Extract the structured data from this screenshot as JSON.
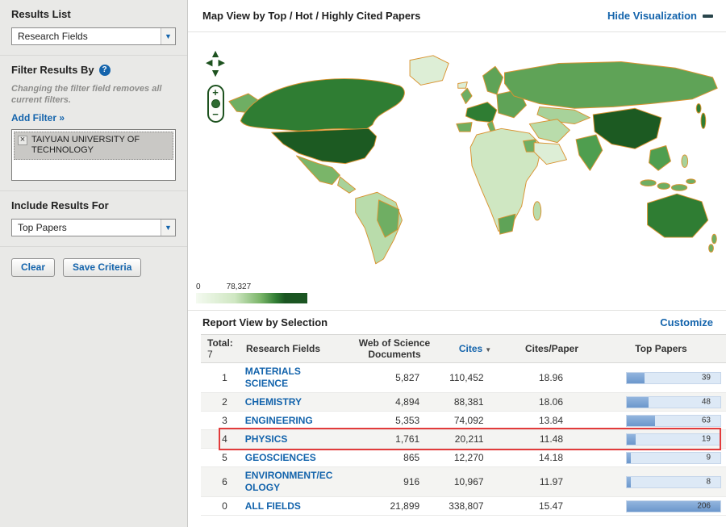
{
  "sidebar": {
    "results_list": {
      "label": "Results List",
      "value": "Research Fields"
    },
    "filter": {
      "title": "Filter Results By",
      "help": "?",
      "note": "Changing the filter field removes all current filters.",
      "add_filter": "Add Filter »",
      "tag": {
        "close": "×",
        "text": "TAIYUAN UNIVERSITY OF TECHNOLOGY"
      }
    },
    "include": {
      "label": "Include Results For",
      "value": "Top Papers"
    },
    "buttons": {
      "clear": "Clear",
      "save": "Save Criteria"
    }
  },
  "map": {
    "title": "Map View by Top / Hot / Highly Cited Papers",
    "hide_link": "Hide Visualization",
    "legend": {
      "min": "0",
      "max": "78,327"
    },
    "controls": {
      "pan_up": "▲",
      "pan_down": "▼",
      "pan_left": "◀",
      "pan_right": "▶",
      "zoom_in": "+",
      "zoom_out": "−"
    }
  },
  "report": {
    "title": "Report View by Selection",
    "customize": "Customize",
    "header": {
      "total_label": "Total:",
      "total_value": "7",
      "research_fields": "Research Fields",
      "docs": "Web of Science Documents",
      "cites": "Cites",
      "sort_icon": "▼",
      "cites_per_paper": "Cites/Paper",
      "top_papers": "Top Papers"
    },
    "rows": [
      {
        "rank": "1",
        "field": "MATERIALS SCIENCE",
        "web_of_science_documents": "5,827",
        "cites": "110,452",
        "cites_per_paper": "18.96",
        "top_papers": "39",
        "highlight": false
      },
      {
        "rank": "2",
        "field": "CHEMISTRY",
        "web_of_science_documents": "4,894",
        "cites": "88,381",
        "cites_per_paper": "18.06",
        "top_papers": "48",
        "highlight": false
      },
      {
        "rank": "3",
        "field": "ENGINEERING",
        "web_of_science_documents": "5,353",
        "cites": "74,092",
        "cites_per_paper": "13.84",
        "top_papers": "63",
        "highlight": false
      },
      {
        "rank": "4",
        "field": "PHYSICS",
        "web_of_science_documents": "1,761",
        "cites": "20,211",
        "cites_per_paper": "11.48",
        "top_papers": "19",
        "highlight": true
      },
      {
        "rank": "5",
        "field": "GEOSCIENCES",
        "web_of_science_documents": "865",
        "cites": "12,270",
        "cites_per_paper": "14.18",
        "top_papers": "9",
        "highlight": false
      },
      {
        "rank": "6",
        "field": "ENVIRONMENT/ECOLOGY",
        "web_of_science_documents": "916",
        "cites": "10,967",
        "cites_per_paper": "11.97",
        "top_papers": "8",
        "highlight": false
      },
      {
        "rank": "0",
        "field": "ALL FIELDS",
        "web_of_science_documents": "21,899",
        "cites": "338,807",
        "cites_per_paper": "15.47",
        "top_papers": "206",
        "highlight": false
      }
    ]
  },
  "colors": {
    "link_blue": "#1464ac",
    "bar_fill": "#6b97cc",
    "bar_track": "#dde9f6",
    "highlight_red": "#e23b3b",
    "map_border_orange": "#d99331",
    "map_min_green": "#f4faf0",
    "map_max_green": "#1b5522"
  }
}
